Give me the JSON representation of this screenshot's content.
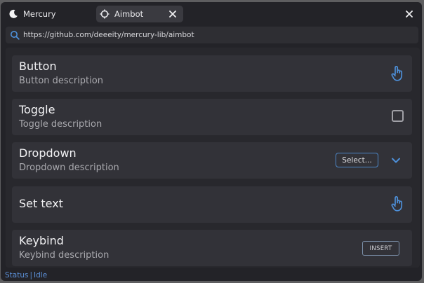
{
  "tabs": [
    {
      "label": "Mercury",
      "icon": "moon-icon",
      "active": false
    },
    {
      "label": "Aimbot",
      "icon": "crosshair-icon",
      "active": true
    }
  ],
  "address_bar": {
    "url": "https://github.com/deeeity/mercury-lib/aimbot"
  },
  "items": [
    {
      "title": "Button",
      "description": "Button description",
      "control": "pointer-hand-icon"
    },
    {
      "title": "Toggle",
      "description": "Toggle description",
      "control": "checkbox"
    },
    {
      "title": "Dropdown",
      "description": "Dropdown description",
      "control": "select",
      "select_label": "Select..."
    },
    {
      "title": "Set text",
      "control": "pointer-hand-icon"
    },
    {
      "title": "Keybind",
      "description": "Keybind description",
      "control": "keybind",
      "key_label": "INSERT"
    }
  ],
  "status": {
    "label": "Status",
    "value": "Idle"
  },
  "colors": {
    "accent": "#4d8fd8",
    "background": "#232328",
    "card": "#323238"
  }
}
